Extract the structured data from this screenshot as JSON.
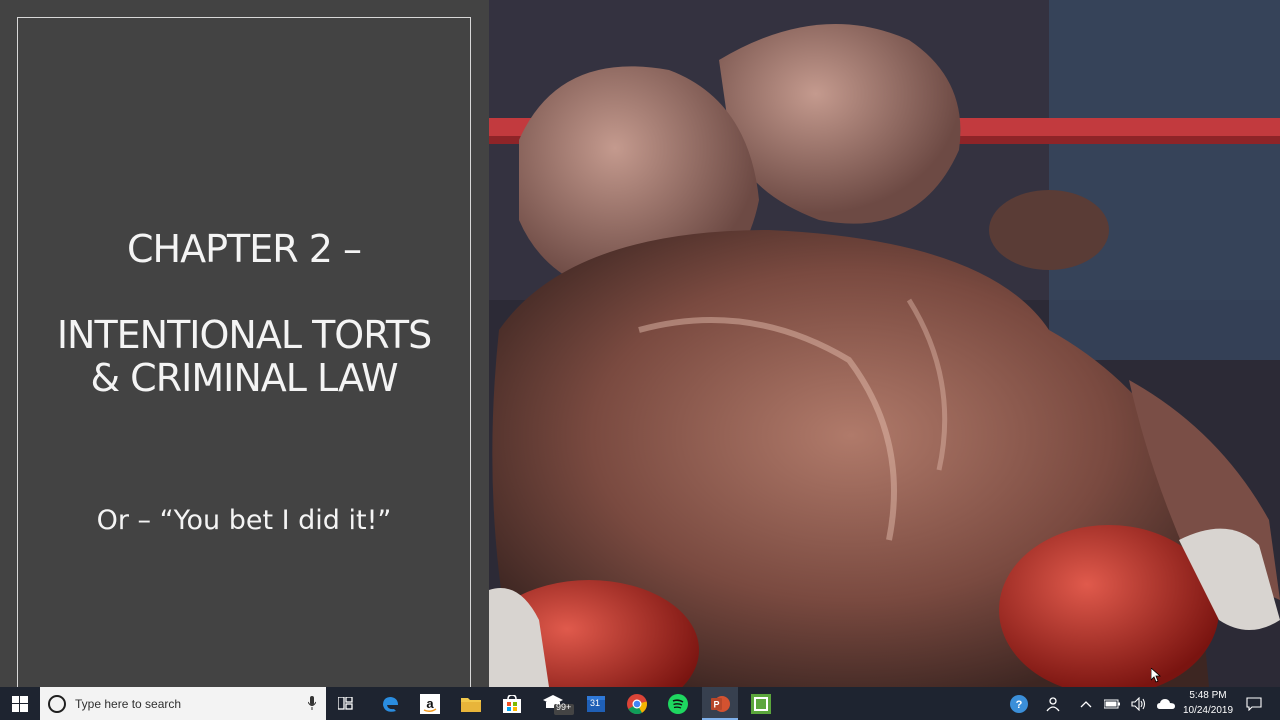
{
  "slide": {
    "title_line1": "CHAPTER 2 –",
    "title_line2a": "INTENTIONAL TORTS",
    "title_line2b": "& CRIMINAL LAW",
    "subtitle": "Or – “You bet I did it!”"
  },
  "taskbar": {
    "search_placeholder": "Type here to search",
    "mail_badge": "99+",
    "calendar_day": "31",
    "time": "5:48 PM",
    "date": "10/24/2019",
    "icons": [
      "windows-start-icon",
      "search-icon",
      "microphone-icon",
      "task-view-icon",
      "edge-icon",
      "amazon-icon",
      "file-explorer-icon",
      "store-icon",
      "mail-icon",
      "calendar-icon",
      "chrome-icon",
      "spotify-icon",
      "powerpoint-icon",
      "camtasia-icon",
      "help-icon",
      "people-icon",
      "chevron-up-icon",
      "battery-icon",
      "volume-icon",
      "onedrive-icon",
      "notification-icon"
    ]
  },
  "colors": {
    "taskbar_bg": "#1e2430",
    "slide_bg": "#434343",
    "active_indicator": "#7fb0ea"
  }
}
